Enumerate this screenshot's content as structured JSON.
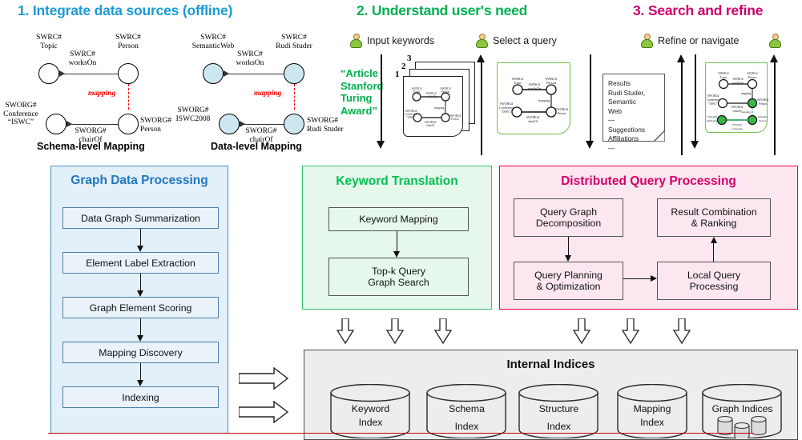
{
  "sections": {
    "one": {
      "title": "1. Integrate data sources (offline)",
      "color": "#1A9BD7"
    },
    "two": {
      "title": "2. Understand user's need",
      "color": "#00B050"
    },
    "three": {
      "title": "3. Search and refine",
      "color": "#C9006B"
    }
  },
  "schema_mapping": {
    "caption": "Schema-level Mapping",
    "nodes": {
      "topic": "SWRC#\nTopic",
      "person_top": "SWRC#\nPerson",
      "conference": "SWORG#\nConference\n“ISWC”",
      "person_bottom": "SWORG#\nPerson"
    },
    "edges": {
      "worksOn": "SWRC#\nworksOn",
      "chairOf": "SWORG#\nchairOf",
      "mapping": "mapping"
    }
  },
  "data_mapping": {
    "caption": "Data-level Mapping",
    "nodes": {
      "semanticweb": "SWRC#\nSemanticWeb",
      "rudi_top": "SWRC#\nRudi Studer",
      "iswc2008": "SWORG#\nISWC2008",
      "rudi_bottom": "SWORG#\nRudi Studer"
    },
    "edges": {
      "worksOn": "SWRC#\nworksOn",
      "chairOf": "SWORG#\nchairOf",
      "mapping": "mapping"
    }
  },
  "users": [
    {
      "label": "Input keywords"
    },
    {
      "label": "Select a query"
    },
    {
      "label": "Refine or navigate"
    },
    {
      "label": ""
    }
  ],
  "keywords": {
    "text": "“Article\nStanford\nTuring\nAward”"
  },
  "query_stack": {
    "numbers": [
      "1",
      "2",
      "3"
    ]
  },
  "results_note": {
    "text": "Results\nRudi Studer, Semantic\nWeb\n—\nSuggestions\nAffiliations\n—"
  },
  "mini_graph": {
    "nodes": {
      "topic": "SWRC#\nTopic",
      "person": "SWRC#\nPerson",
      "conference": "SWORG#\nConference\n“ISWC”",
      "person2": "SWORG#\nPerson",
      "affiliation": "SWpub#\nAffiliation",
      "person3": "SWpub#\nPerson"
    },
    "edges": {
      "worksOn": "SWRC#\nworksOn",
      "chairOf": "SWORG#\nchairOf",
      "mapping": "mapping",
      "workedAt": "SWpub#\nworkedAt"
    }
  },
  "panels": {
    "graph_data_processing": {
      "title": "Graph Data Processing",
      "accent": "#1F77BF",
      "steps": [
        "Data Graph Summarization",
        "Element Label Extraction",
        "Graph Element Scoring",
        "Mapping Discovery",
        "Indexing"
      ]
    },
    "keyword_translation": {
      "title": "Keyword Translation",
      "accent": "#00C050",
      "steps": [
        "Keyword Mapping",
        "Top-k Query\nGraph Search"
      ]
    },
    "distributed_query_processing": {
      "title": "Distributed Query Processing",
      "accent": "#D4006A",
      "steps": [
        "Query Graph\nDecomposition",
        "Result Combination\n& Ranking",
        "Query Planning\n& Optimization",
        "Local Query\nProcessing"
      ]
    }
  },
  "internal_indices": {
    "title": "Internal Indices",
    "items": [
      {
        "line1": "Keyword",
        "line2": "Index"
      },
      {
        "line1": "Schema",
        "line2": "Index"
      },
      {
        "line1": "Structure",
        "line2": "Index"
      },
      {
        "line1": "Mapping",
        "line2": "Index"
      },
      {
        "line1": "Graph Indices",
        "line2": ""
      }
    ]
  }
}
